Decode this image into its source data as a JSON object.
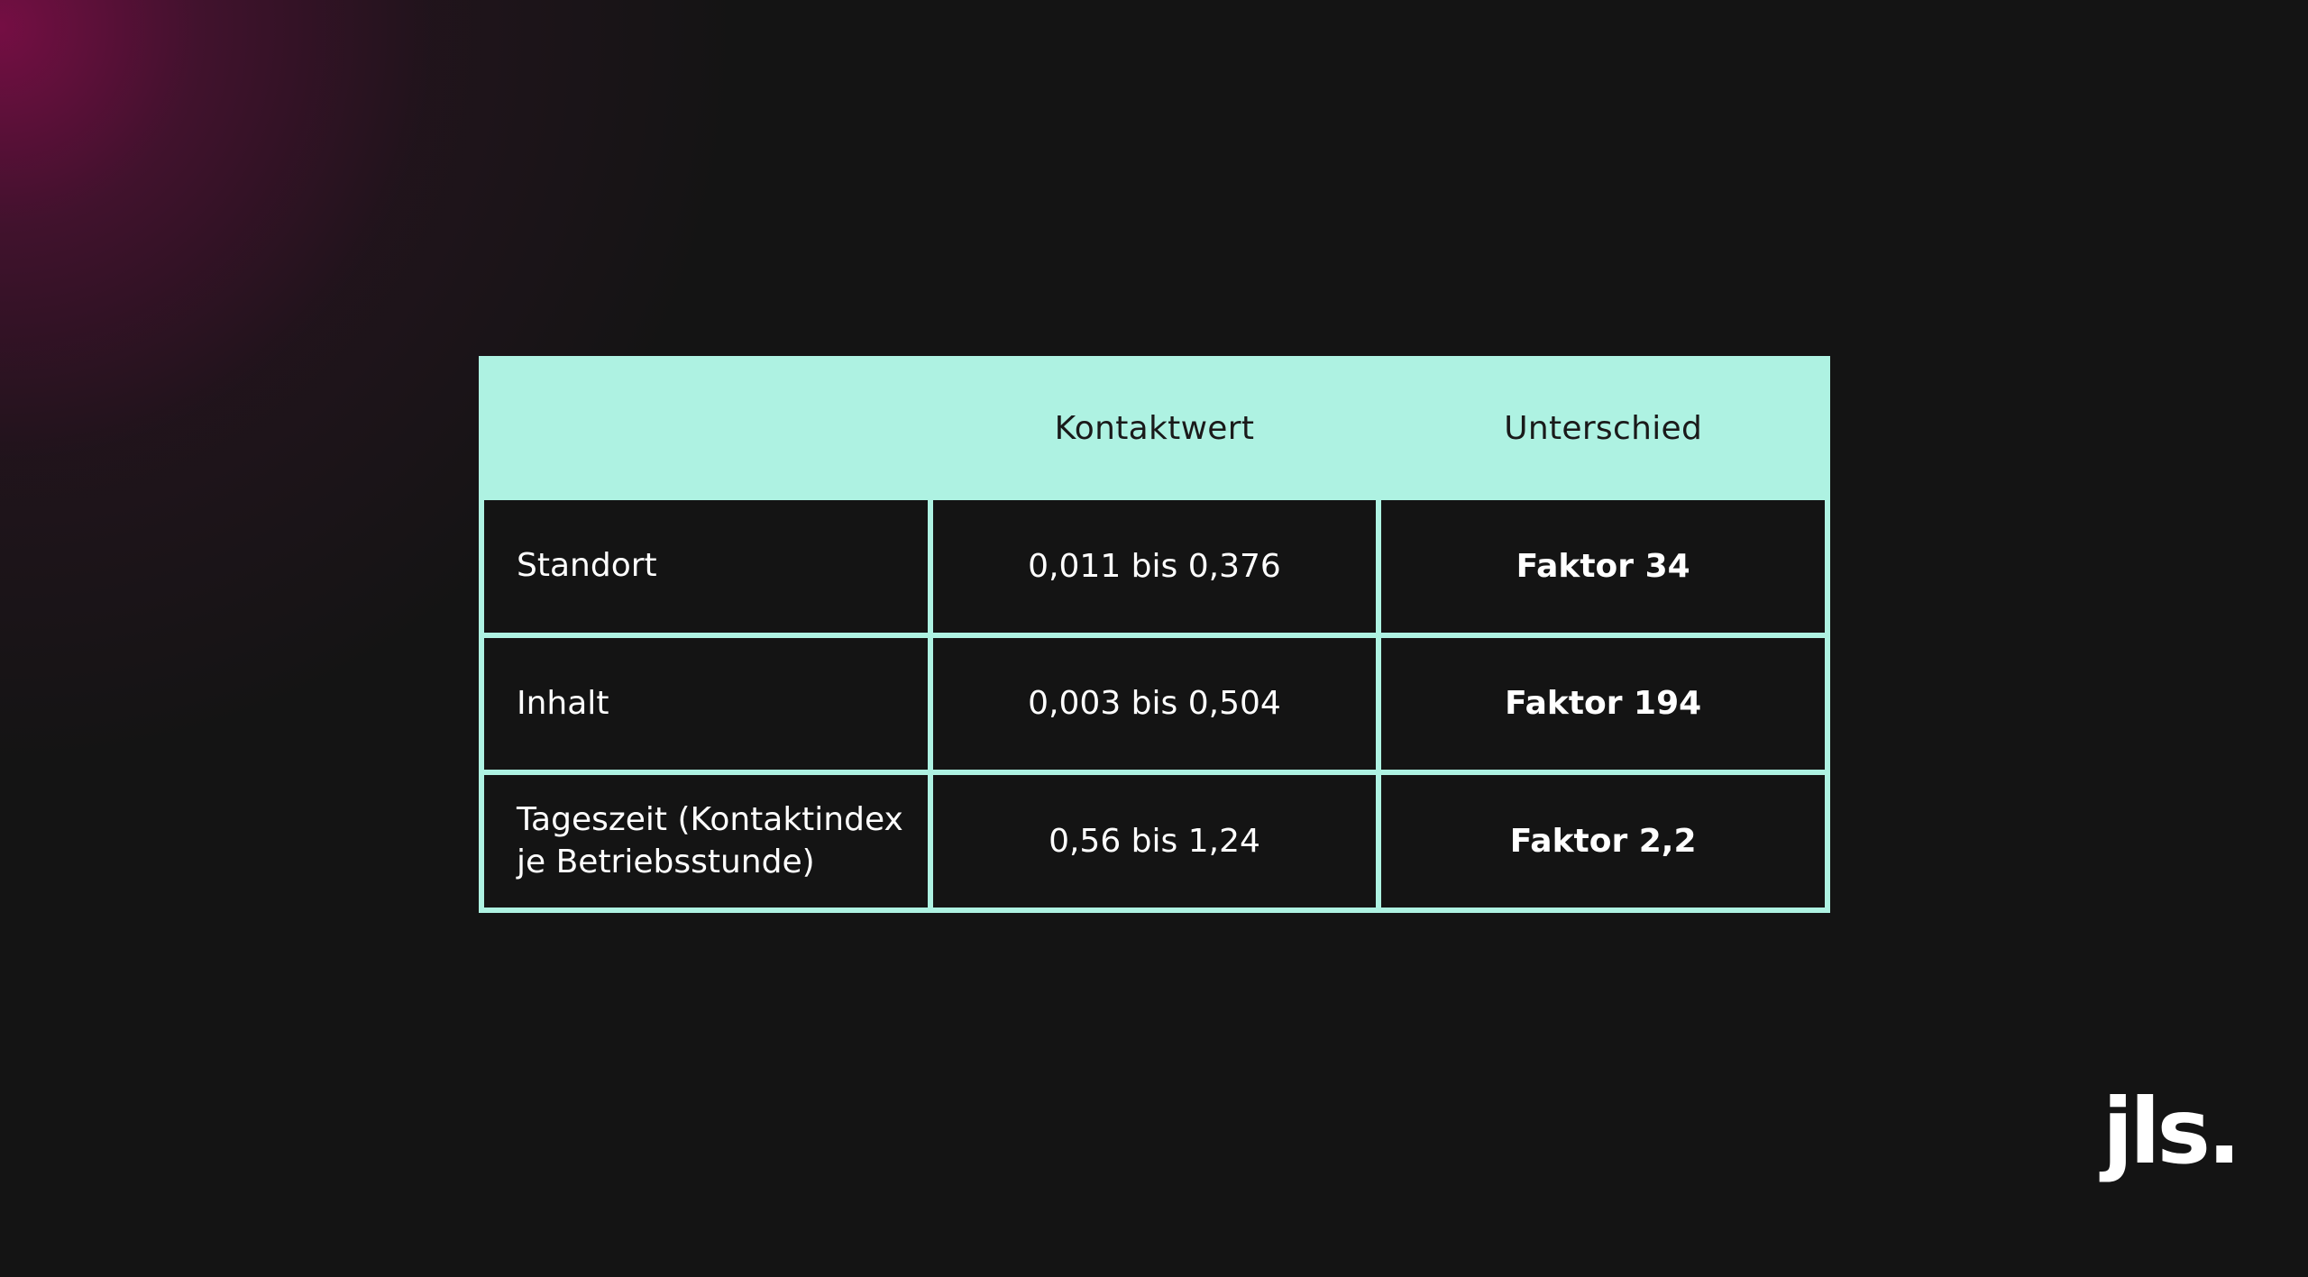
{
  "table": {
    "headers": [
      "",
      "Kontaktwert",
      "Unterschied"
    ],
    "rows": [
      {
        "label": "Standort",
        "value": "0,011 bis 0,376",
        "factor": "Faktor 34"
      },
      {
        "label": "Inhalt",
        "value": "0,003 bis 0,504",
        "factor": "Faktor 194"
      },
      {
        "label": "Tageszeit (Kontaktindex je Betriebsstunde)",
        "value": "0,56 bis 1,24",
        "factor": "Faktor 2,2"
      }
    ]
  },
  "logo": {
    "text": "jls."
  },
  "colors": {
    "background": "#141414",
    "accent": "#aef2e2",
    "glow": "#7a0e46"
  }
}
